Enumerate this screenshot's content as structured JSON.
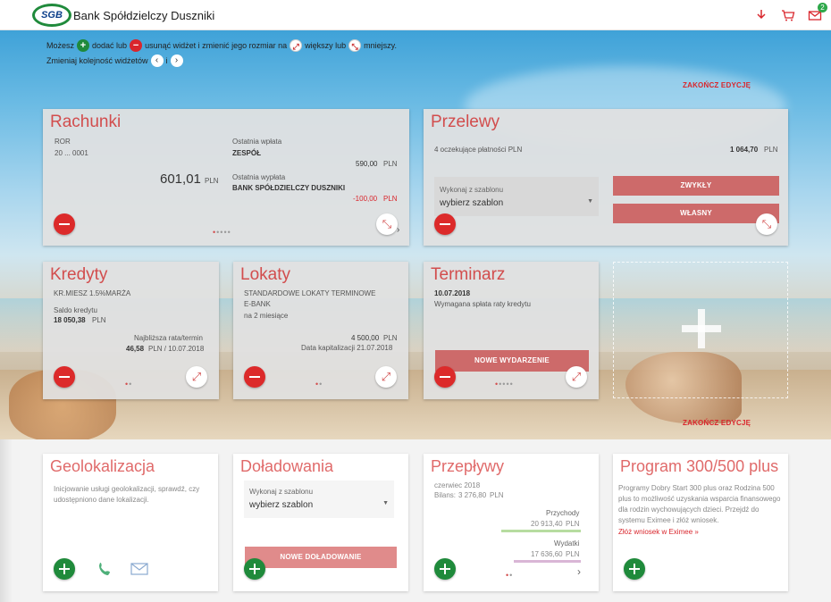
{
  "header": {
    "logo_mark": "SGB",
    "bank_name": "Bank Spółdzielczy Duszniki",
    "icons": [
      "download-icon",
      "cart-icon",
      "mail-icon"
    ],
    "mail_badge": "2"
  },
  "hints": {
    "line1_a": "Możesz",
    "line1_b": "dodać lub",
    "line1_c": "usunąć widżet i zmienić jego rozmiar na",
    "line1_d": "większy lub",
    "line1_e": "mniejszy.",
    "line2_a": "Zmieniaj kolejność widżetów",
    "line2_b": "i"
  },
  "end_edit_label": "ZAKOŃCZ EDYCJĘ",
  "rachunki": {
    "title": "Rachunki",
    "account_type": "ROR",
    "account_number": "20 ... 0001",
    "balance": "601,01",
    "currency": "PLN",
    "last_in_label": "Ostatnia wpłata",
    "last_in_name": "ZESPÓŁ",
    "last_in_amount": "590,00",
    "last_out_label": "Ostatnia wypłata",
    "last_out_name": "BANK SPÓŁDZIELCZY DUSZNIKI",
    "last_out_amount": "-100,00"
  },
  "przelewy": {
    "title": "Przelewy",
    "pending": "4 oczekujące płatności PLN",
    "pending_amount": "1 064,70",
    "currency": "PLN",
    "template_label": "Wykonaj z szablonu",
    "template_value": "wybierz szablon",
    "btn_regular": "ZWYKŁY",
    "btn_own": "WŁASNY"
  },
  "kredyty": {
    "title": "Kredyty",
    "name": "KR.MIESZ 1.5%MARŻA",
    "balance_label": "Saldo kredytu",
    "balance": "18 050,38",
    "currency": "PLN",
    "next_label": "Najbliższa rata/termin",
    "next_amount": "46,58",
    "next_date": "PLN / 10.07.2018"
  },
  "lokaty": {
    "title": "Lokaty",
    "name1": "STANDARDOWE LOKATY TERMINOWE",
    "name2": "E-BANK",
    "term": "na 2 miesiące",
    "amount": "4 500,00",
    "currency": "PLN",
    "cap_date": "Data kapitalizacji 21.07.2018"
  },
  "terminarz": {
    "title": "Terminarz",
    "date": "10.07.2018",
    "desc": "Wymagana spłata raty kredytu",
    "btn": "NOWE WYDARZENIE"
  },
  "geolokalizacja": {
    "title": "Geolokalizacja",
    "text": "Inicjowanie usługi geolokalizacji, sprawdź, czy udostępniono dane lokalizacji."
  },
  "doladowania": {
    "title": "Doładowania",
    "template_label": "Wykonaj z szablonu",
    "template_value": "wybierz szablon",
    "btn": "NOWE DOŁADOWANIE"
  },
  "przeplywy": {
    "title": "Przepływy",
    "month": "czerwiec 2018",
    "balance_label": "Bilans:",
    "balance": "3 276,80",
    "currency": "PLN",
    "income_label": "Przychody",
    "income": "20 913,40",
    "expense_label": "Wydatki",
    "expense": "17 636,60"
  },
  "program": {
    "title": "Program 300/500 plus",
    "text": "Programy Dobry Start 300 plus oraz Rodzina 500 plus to możliwość uzyskania wsparcia finansowego dla rodzin wychowujących dzieci. Przejdź do systemu Eximee i złóż wniosek.",
    "link": "Złóż wniosek w Eximee »"
  },
  "colors": {
    "accent_red": "#d24d4d",
    "brand_green": "#1f8a3b",
    "income_bar": "#b7dca0",
    "expense_bar": "#d9b6d6"
  }
}
